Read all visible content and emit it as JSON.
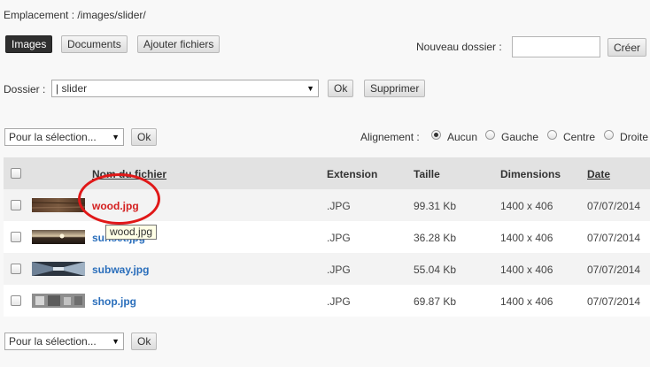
{
  "location": "Emplacement : /images/slider/",
  "tabs": [
    {
      "label": "Images",
      "active": true
    },
    {
      "label": "Documents",
      "active": false
    },
    {
      "label": "Ajouter fichiers",
      "active": false
    }
  ],
  "new_folder": {
    "label": "Nouveau dossier :",
    "value": "",
    "button": "Créer"
  },
  "folder": {
    "label": "Dossier :",
    "selected": "|  slider",
    "ok": "Ok",
    "delete": "Supprimer"
  },
  "selection_top": {
    "selected": "Pour la sélection...",
    "ok": "Ok"
  },
  "alignment": {
    "label": "Alignement :",
    "options": [
      {
        "label": "Aucun",
        "checked": true
      },
      {
        "label": "Gauche",
        "checked": false
      },
      {
        "label": "Centre",
        "checked": false
      },
      {
        "label": "Droite",
        "checked": false
      }
    ]
  },
  "table": {
    "headers": {
      "name": "Nom du fichier",
      "extension": "Extension",
      "size": "Taille",
      "dimensions": "Dimensions",
      "date": "Date"
    },
    "rows": [
      {
        "name": "wood.jpg",
        "extension": ".JPG",
        "size": "99.31 Kb",
        "dimensions": "1400 x 406",
        "date": "07/07/2014"
      },
      {
        "name": "sunset.jpg",
        "extension": ".JPG",
        "size": "36.28 Kb",
        "dimensions": "1400 x 406",
        "date": "07/07/2014"
      },
      {
        "name": "subway.jpg",
        "extension": ".JPG",
        "size": "55.04 Kb",
        "dimensions": "1400 x 406",
        "date": "07/07/2014"
      },
      {
        "name": "shop.jpg",
        "extension": ".JPG",
        "size": "69.87 Kb",
        "dimensions": "1400 x 406",
        "date": "07/07/2014"
      }
    ]
  },
  "tooltip": "wood.jpg",
  "selection_bottom": {
    "selected": "Pour la sélection...",
    "ok": "Ok"
  },
  "colors": {
    "link": "#2a6ebb",
    "highlight": "#d42020",
    "annotation_circle": "#e01818"
  }
}
